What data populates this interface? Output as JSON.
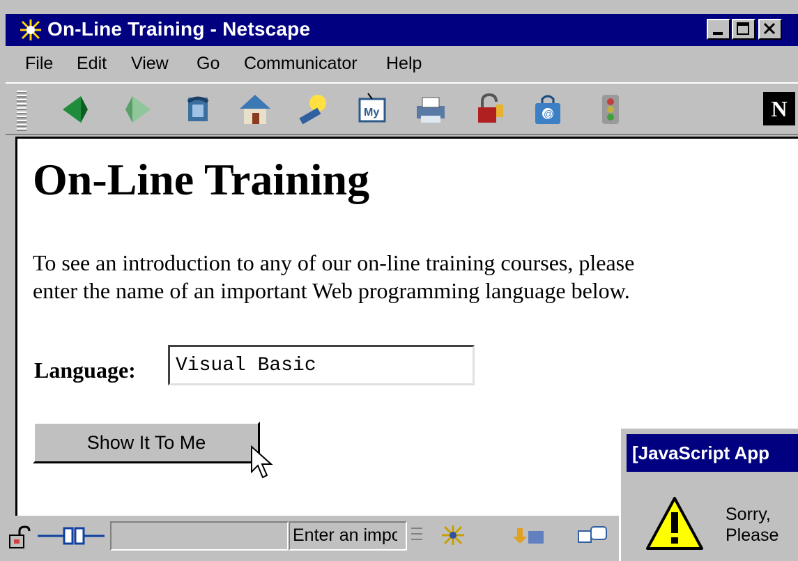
{
  "window": {
    "title": "On-Line Training - Netscape",
    "controls": [
      "minimize",
      "maximize",
      "close"
    ]
  },
  "menu": {
    "items": [
      {
        "label": "File"
      },
      {
        "label": "Edit"
      },
      {
        "label": "View"
      },
      {
        "label": "Go"
      },
      {
        "label": "Communicator"
      },
      {
        "label": "Help"
      }
    ]
  },
  "toolbar": {
    "icons": [
      "back-icon",
      "forward-icon",
      "reload-icon",
      "home-icon",
      "search-icon",
      "my-netscape-icon",
      "print-icon",
      "security-icon",
      "shop-icon",
      "stop-icon"
    ],
    "logo": "N"
  },
  "page": {
    "title": "On-Line Training",
    "intro_line1": "To see an introduction to any of our on-line training courses, please",
    "intro_line2": "enter the name of an important Web programming language below.",
    "language_label": "Language:",
    "language_value": "Visual Basic",
    "submit_label": "Show It To Me"
  },
  "statusbar": {
    "text": "Enter an impor"
  },
  "alert": {
    "title": "[JavaScript App",
    "message_line1": "Sorry,",
    "message_line2": "Please"
  },
  "colors": {
    "titlebar": "#000080",
    "chrome": "#c0c0c0",
    "content_bg": "#ffffff"
  }
}
